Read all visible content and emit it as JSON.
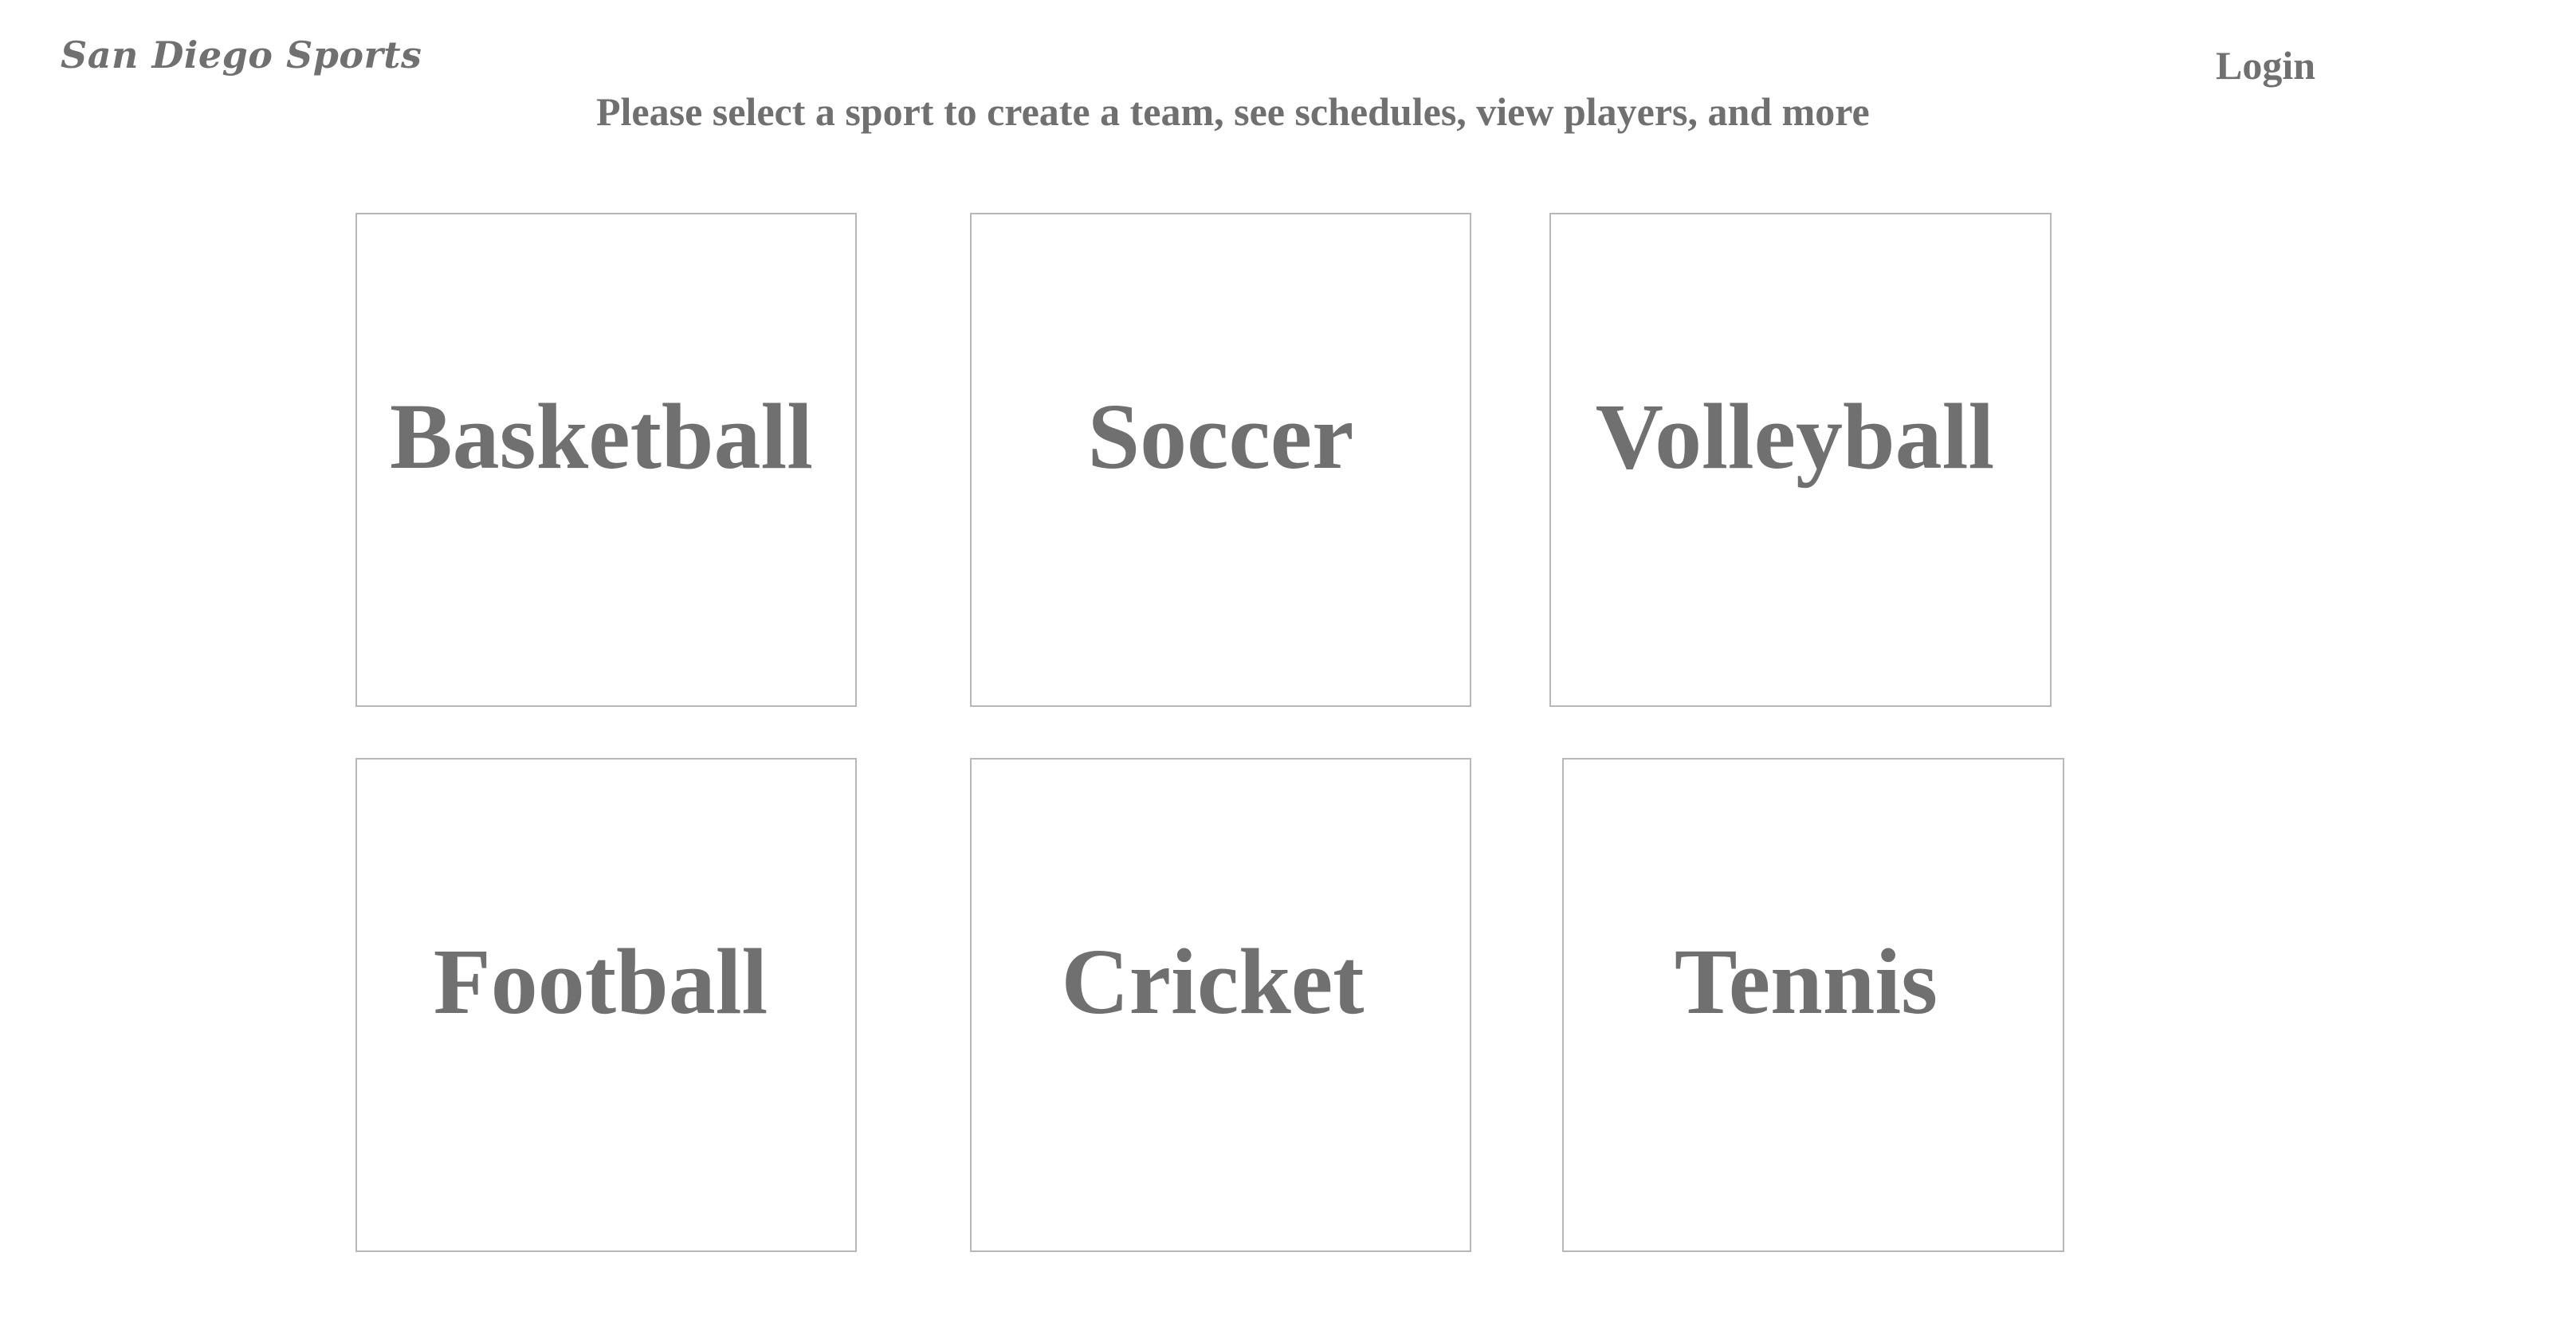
{
  "header": {
    "logo_text": "San Diego Sports",
    "login_label": "Login",
    "subtitle": "Please select a sport to create a team, see schedules, view players, and more"
  },
  "sports": [
    {
      "label": "Basketball"
    },
    {
      "label": "Soccer"
    },
    {
      "label": "Volleyball"
    },
    {
      "label": "Football"
    },
    {
      "label": "Cricket"
    },
    {
      "label": "Tennis"
    }
  ],
  "colors": {
    "text": "#707070",
    "tile_border": "#b8b8b8",
    "background": "#ffffff"
  }
}
